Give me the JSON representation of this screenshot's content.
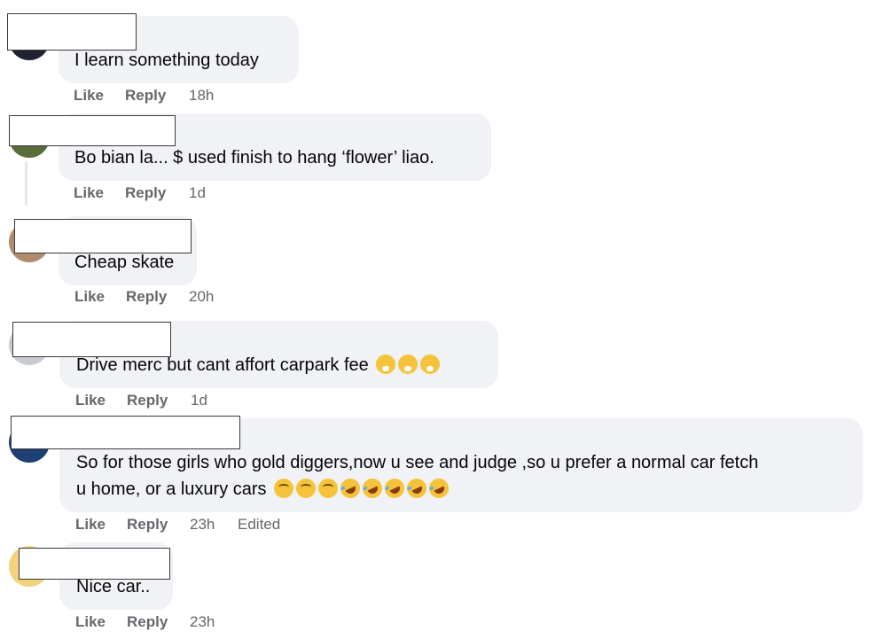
{
  "actions": {
    "like": "Like",
    "reply": "Reply"
  },
  "comments": [
    {
      "text": "I learn something today",
      "time": "18h",
      "edited": ""
    },
    {
      "text": "Bo bian la... $ used finish to hang ‘flower’ liao.",
      "time": "1d",
      "edited": ""
    },
    {
      "text": "Cheap skate",
      "time": "20h",
      "edited": ""
    },
    {
      "text": "Drive merc but cant affort carpark fee",
      "emojis": [
        "face-with-hand-over-mouth",
        "face-with-hand-over-mouth",
        "face-with-hand-over-mouth"
      ],
      "time": "1d",
      "edited": ""
    },
    {
      "text_line1": "So for those girls who gold diggers,now u see and judge ,so u prefer a normal car fetch",
      "text_line2": "u home, or a luxury cars",
      "emojis": [
        "face-with-rolling-eyes",
        "face-with-rolling-eyes",
        "face-with-rolling-eyes",
        "rolling-on-the-floor-laughing",
        "rolling-on-the-floor-laughing",
        "rolling-on-the-floor-laughing",
        "rolling-on-the-floor-laughing",
        "rolling-on-the-floor-laughing"
      ],
      "time": "23h",
      "edited": "Edited"
    },
    {
      "text": "Nice car..",
      "time": "23h",
      "edited": ""
    }
  ],
  "colors": {
    "bubble": "#f0f2f5",
    "meta_text": "#65676b",
    "text": "#050505"
  }
}
